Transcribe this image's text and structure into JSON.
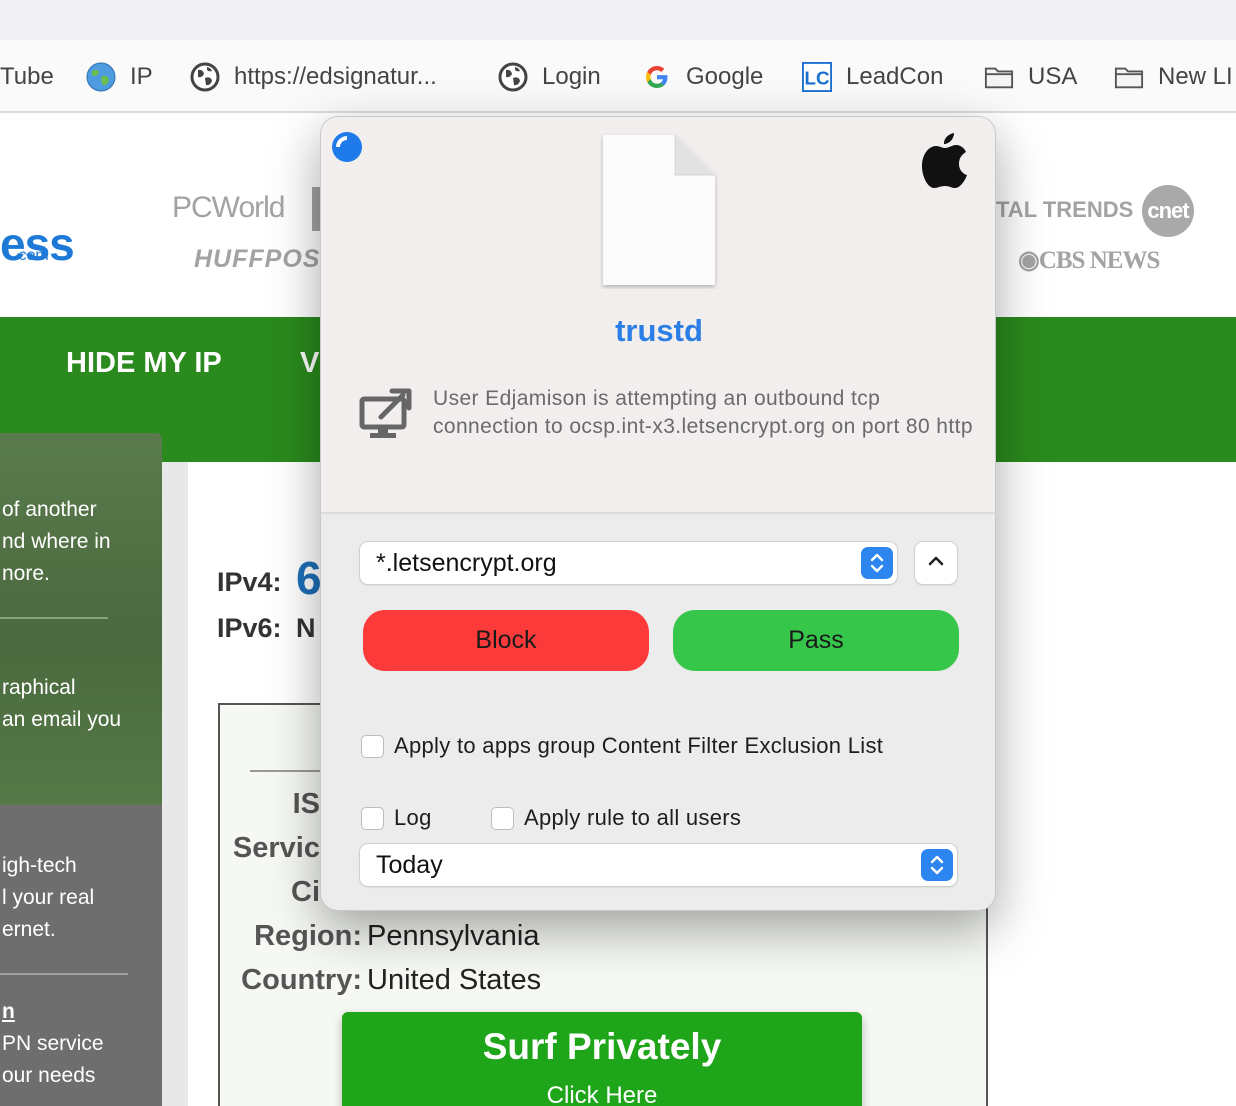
{
  "bookmarks": [
    {
      "label": "Tube",
      "icon": "none"
    },
    {
      "label": "IP",
      "icon": "globe-color-icon"
    },
    {
      "label": "https://edsignatur...",
      "icon": "globe-icon"
    },
    {
      "label": "Login",
      "icon": "globe-icon"
    },
    {
      "label": "Google",
      "icon": "google-icon"
    },
    {
      "label": "LeadCon",
      "icon": "leadcon-icon"
    },
    {
      "label": "USA",
      "icon": "folder-icon"
    },
    {
      "label": "New LI",
      "icon": "folder-icon"
    }
  ],
  "page": {
    "logo_main": "ess",
    "logo_domain": ".com",
    "press": {
      "pcworld": "PCWorld",
      "huffpost": "HUFFPOS",
      "digital_trends": "TAL TRENDS",
      "cnet": "cnet",
      "cbs": "CBS NEWS"
    },
    "nav": [
      "HIDE MY IP",
      "V"
    ],
    "sidebar": {
      "block1": [
        "of another",
        "nd where in",
        "nore."
      ],
      "block2": [
        "raphical",
        " an email you"
      ],
      "block3": [
        "igh-tech",
        "l your real",
        "ernet."
      ],
      "block4_link": "n",
      "block4": [
        "PN service",
        "our needs"
      ]
    },
    "ipv4_label": "IPv4:",
    "ipv4_value": "6",
    "ipv6_label": "IPv6:",
    "ipv6_value": "N",
    "info_rows": [
      {
        "label": "IS",
        "value": ""
      },
      {
        "label": "Servic",
        "value": ""
      },
      {
        "label": "Ci",
        "value": ""
      },
      {
        "label": "Region:",
        "value": "Pennsylvania"
      },
      {
        "label": "Country:",
        "value": "United States"
      }
    ],
    "cta_title": "Surf Privately",
    "cta_sub": "Click Here"
  },
  "dialog": {
    "app_name": "trustd",
    "message": "User Edjamison is attempting an outbound tcp connection to ocsp.int-x3.letsencrypt.org on port 80 http",
    "domain_select": "*.letsencrypt.org",
    "block_label": "Block",
    "pass_label": "Pass",
    "exclusion_label": "Apply to apps group Content Filter Exclusion List",
    "log_label": "Log",
    "all_users_label": "Apply rule to all users",
    "duration_select": "Today",
    "colors": {
      "block": "#fd3a3a",
      "pass": "#35c64a",
      "accent": "#2d86f0",
      "app_name": "#2a7ee6"
    }
  }
}
